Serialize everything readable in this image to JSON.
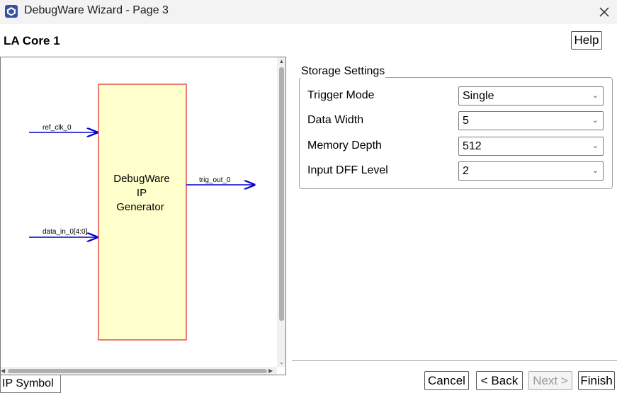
{
  "window": {
    "title": "DebugWare Wizard - Page 3"
  },
  "header": {
    "core_title": "LA Core 1",
    "help_label": "Help"
  },
  "symbol": {
    "block_title": [
      "DebugWare",
      "IP",
      "Generator"
    ],
    "inputs": [
      "ref_clk_0",
      "data_in_0[4:0]"
    ],
    "outputs": [
      "trig_out_0"
    ],
    "tab_label": "IP Symbol",
    "colors": {
      "block_fill": "#ffffcc",
      "block_border": "#e05050",
      "wire": "#0000cc"
    }
  },
  "storage": {
    "group_title": "Storage Settings",
    "settings": [
      {
        "label": "Trigger Mode",
        "value": "Single"
      },
      {
        "label": "Data Width",
        "value": "5"
      },
      {
        "label": "Memory Depth",
        "value": "512"
      },
      {
        "label": "Input DFF Level",
        "value": "2"
      }
    ]
  },
  "buttons": {
    "cancel": "Cancel",
    "back": "< Back",
    "next": "Next >",
    "finish": "Finish"
  }
}
